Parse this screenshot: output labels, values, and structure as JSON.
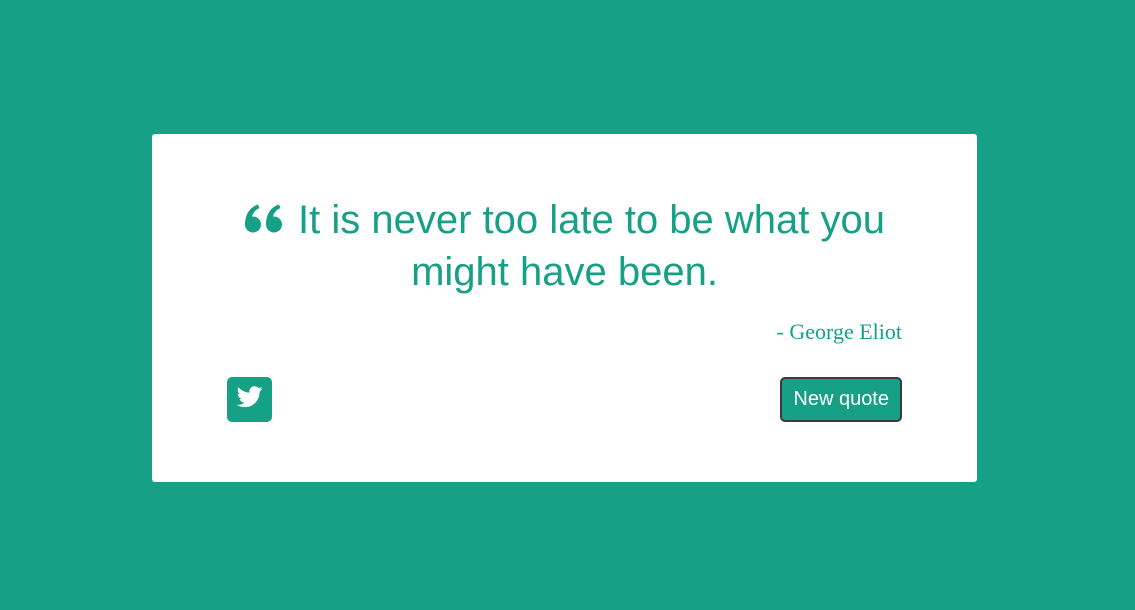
{
  "quote": {
    "text": "It is never too late to be what you might have been.",
    "author": "- George Eliot",
    "icon": "quote-left-icon"
  },
  "actions": {
    "tweet_icon": "twitter-icon",
    "new_quote_label": "New quote"
  },
  "colors": {
    "accent": "#16a085",
    "card": "#ffffff",
    "button_border": "#3a3a3a"
  }
}
